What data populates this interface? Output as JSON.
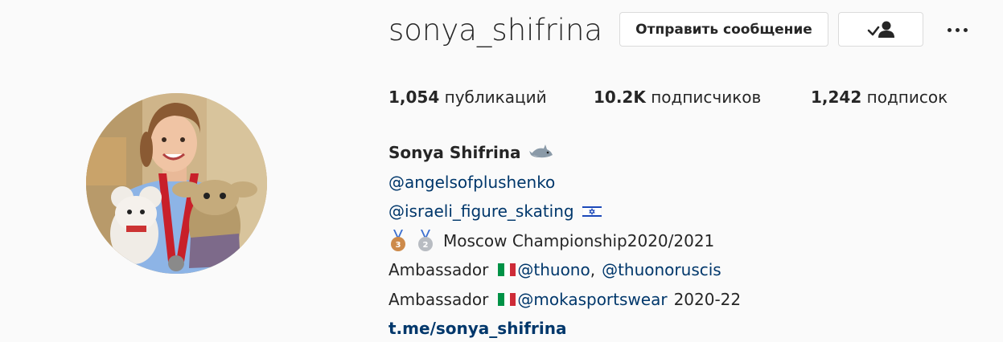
{
  "profile": {
    "username": "sonya_shifrina",
    "message_button": "Отправить сообщение",
    "stats": {
      "posts_count": "1,054",
      "posts_label": "публикаций",
      "followers_count": "10.2K",
      "followers_label": "подписчиков",
      "following_count": "1,242",
      "following_label": "подписок"
    },
    "bio": {
      "full_name": "Sonya Shifrina",
      "name_emoji": "shark-emoji",
      "line1": "@angelsofplushenko",
      "line2": "@israeli_figure_skating",
      "line2_flag": "israel-flag",
      "line3_text": "Moscow Championship2020/2021",
      "line4_prefix": "Ambassador",
      "line4_link1": "@thuono",
      "line4_sep": ",",
      "line4_link2": "@thuonoruscis",
      "line5_prefix": "Ambassador",
      "line5_link": "@mokasportswear",
      "line5_suffix": "2020-22",
      "website": "t.me/sonya_shifrina"
    }
  },
  "colors": {
    "background": "#fafafa",
    "text": "#262626",
    "link": "#00376b",
    "border": "#dbdbdb"
  }
}
